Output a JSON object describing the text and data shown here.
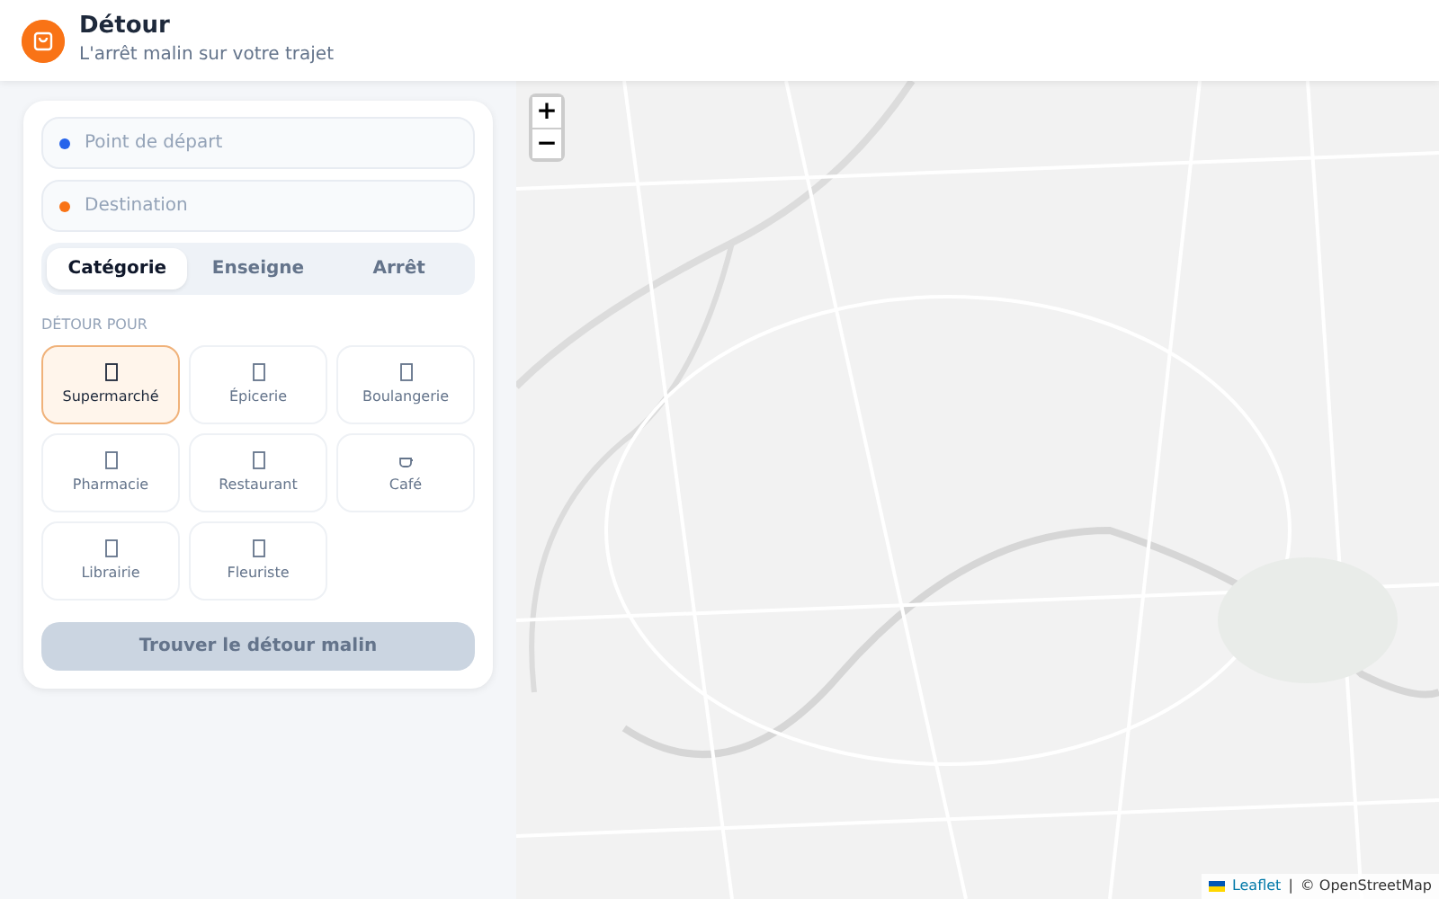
{
  "header": {
    "title": "Détour",
    "subtitle": "L'arrêt malin sur votre trajet"
  },
  "fields": [
    {
      "placeholder": "Point de départ",
      "color": "#2563eb"
    },
    {
      "placeholder": "Destination",
      "color": "#f97316"
    }
  ],
  "tabs": [
    {
      "label": "Catégorie",
      "selected": true
    },
    {
      "label": "Enseigne",
      "selected": false
    },
    {
      "label": "Arrêt",
      "selected": false
    }
  ],
  "section_label": "DÉTOUR POUR",
  "categories": [
    {
      "label": "Supermarché",
      "kind": "missing-glyph",
      "selected": true
    },
    {
      "label": "Épicerie",
      "kind": "missing-glyph",
      "selected": false
    },
    {
      "label": "Boulangerie",
      "kind": "missing-glyph",
      "selected": false
    },
    {
      "label": "Pharmacie",
      "kind": "missing-glyph",
      "selected": false
    },
    {
      "label": "Restaurant",
      "kind": "missing-glyph",
      "selected": false
    },
    {
      "label": "Café",
      "kind": "cup",
      "selected": false
    },
    {
      "label": "Librairie",
      "kind": "missing-glyph",
      "selected": false
    },
    {
      "label": "Fleuriste",
      "kind": "missing-glyph",
      "selected": false
    }
  ],
  "submit_button": {
    "label": "Trouver le détour malin",
    "disabled": true
  },
  "map": {
    "zoom_in": "+",
    "zoom_out": "−",
    "attribution_link": "Leaflet",
    "attribution_separator": "|",
    "attribution_text": "© OpenStreetMap"
  }
}
